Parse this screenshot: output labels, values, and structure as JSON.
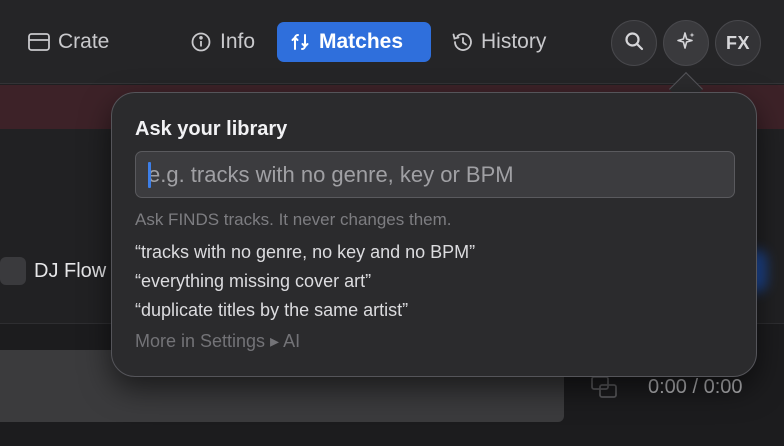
{
  "toolbar": {
    "tabs": [
      {
        "label": "Crate",
        "icon": "crate-icon"
      },
      {
        "label": "Info",
        "icon": "info-icon"
      },
      {
        "label": "Matches",
        "icon": "matches-icon",
        "active": true
      },
      {
        "label": "History",
        "icon": "history-icon"
      }
    ],
    "fx_label": "FX",
    "accent_color": "#2f6fdc"
  },
  "background": {
    "playlist_label": "DJ Flow",
    "time_readout": "0:00 / 0:00"
  },
  "popover": {
    "title": "Ask your library",
    "input_placeholder": "e.g. tracks with no genre, key or BPM",
    "input_value": "",
    "note": "Ask FINDS tracks. It never changes them.",
    "suggestions": [
      "“tracks with no genre, no key and no BPM”",
      "“everything missing cover art”",
      "“duplicate titles by the same artist”"
    ],
    "more_link": "More in Settings ▸ AI"
  }
}
